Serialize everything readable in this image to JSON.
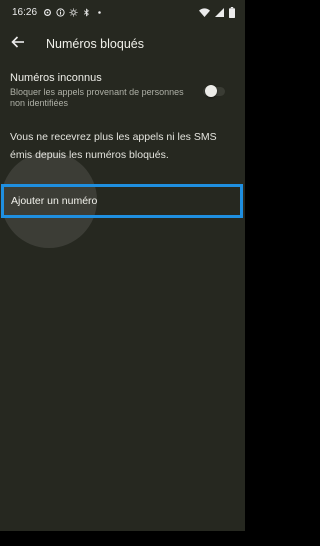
{
  "status_bar": {
    "time": "16:26",
    "left_icons": [
      "settings-icon",
      "info-icon",
      "brightness-icon",
      "bluetooth-icon",
      "dot-icon"
    ],
    "right_icons": [
      "wifi-icon",
      "signal-icon",
      "battery-icon"
    ]
  },
  "app_bar": {
    "title": "Numéros bloqués"
  },
  "unknown_numbers": {
    "title": "Numéros inconnus",
    "subtitle": "Bloquer les appels provenant de personnes non identifiées",
    "toggle_on": false
  },
  "info": {
    "text": "Vous ne recevrez plus les appels ni les SMS émis depuis les numéros bloqués."
  },
  "add_number": {
    "label": "Ajouter un numéro"
  },
  "colors": {
    "background": "#262820",
    "highlight_border": "#1f8fe0"
  }
}
